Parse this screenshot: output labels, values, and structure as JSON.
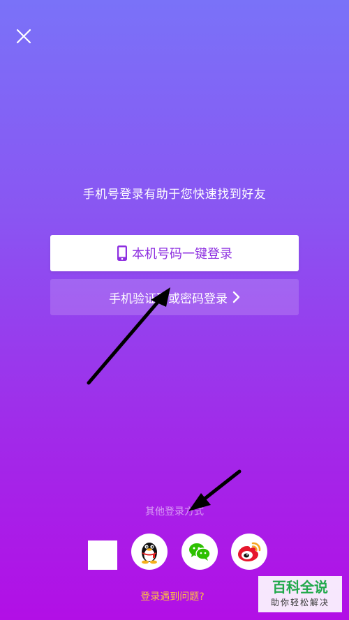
{
  "tagline": "手机号登录有助于您快速找到好友",
  "primary_button": {
    "label": "本机号码一键登录",
    "icon": "phone-icon"
  },
  "secondary_button": {
    "label": "手机验证码或密码登录",
    "icon": "chevron-right-icon"
  },
  "other_login_label": "其他登录方式",
  "social_logins": [
    {
      "name": "blank",
      "icon": "blank-square"
    },
    {
      "name": "qq",
      "icon": "qq-penguin-icon"
    },
    {
      "name": "wechat",
      "icon": "wechat-icon"
    },
    {
      "name": "weibo",
      "icon": "weibo-icon"
    }
  ],
  "help_link": "登录遇到问题?",
  "watermark": {
    "main": "百科全说",
    "sub": "助你轻松解决"
  },
  "colors": {
    "accent": "#8e2fe0",
    "help": "#ffc43d",
    "watermark": "#20a84a"
  }
}
